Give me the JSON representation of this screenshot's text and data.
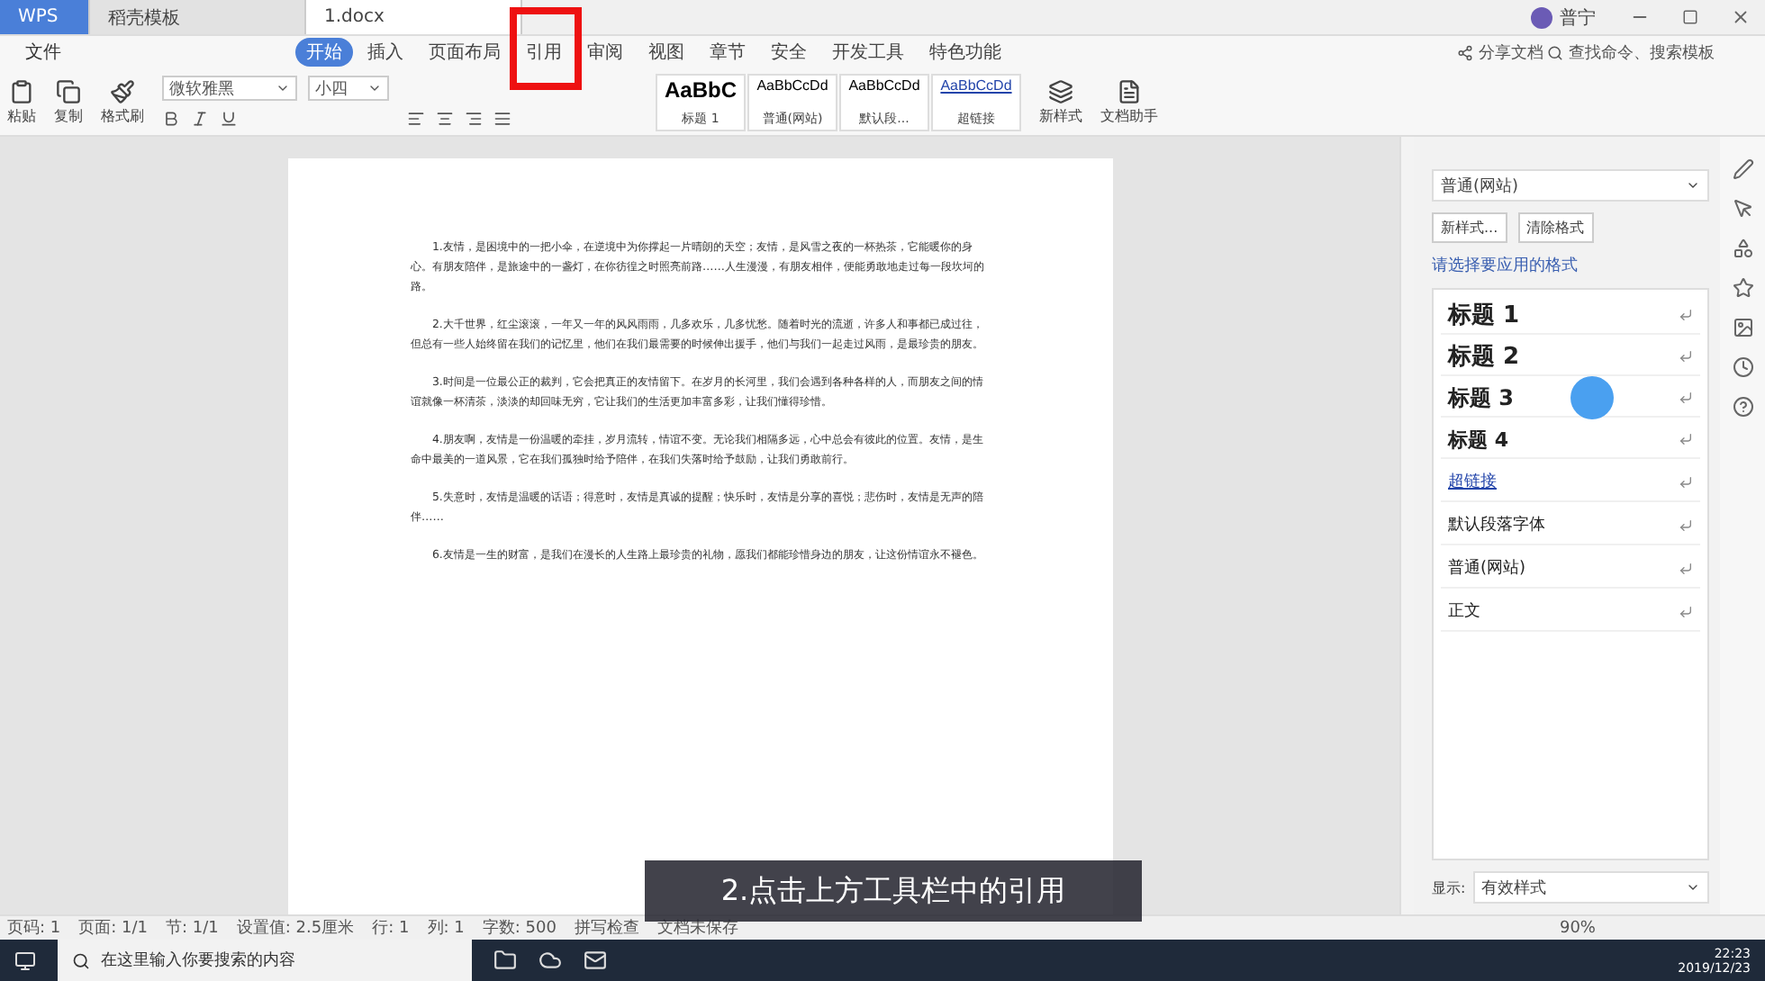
{
  "title_tabs": [
    {
      "label": "WPS",
      "selected": false,
      "kind": "home"
    },
    {
      "label": "稻壳模板",
      "selected": false,
      "kind": "doc"
    },
    {
      "label": "1.docx",
      "selected": true,
      "kind": "doc"
    }
  ],
  "account": {
    "name": "普宁"
  },
  "menu": {
    "file": "文件",
    "tabs": [
      {
        "label": "开始",
        "selected": true
      },
      {
        "label": "插入",
        "selected": false
      },
      {
        "label": "页面布局",
        "selected": false
      },
      {
        "label": "引用",
        "selected": false
      },
      {
        "label": "审阅",
        "selected": false
      },
      {
        "label": "视图",
        "selected": false
      },
      {
        "label": "章节",
        "selected": false
      },
      {
        "label": "安全",
        "selected": false
      },
      {
        "label": "开发工具",
        "selected": false
      },
      {
        "label": "特色功能",
        "selected": false
      }
    ],
    "share": "分享文档",
    "search_placeholder": "查找命令、搜索模板"
  },
  "ribbon": {
    "clipboard": [
      "粘贴",
      "复制",
      "格式刷"
    ],
    "font": "微软雅黑",
    "size": "小四",
    "styles": [
      {
        "sample": "AaBbC",
        "label": "标题 1",
        "kind": "big"
      },
      {
        "sample": "AaBbCcDd",
        "label": "普通(网站)",
        "kind": "normal"
      },
      {
        "sample": "AaBbCcDd",
        "label": "默认段...",
        "kind": "normal"
      },
      {
        "sample": "AaBbCcDd",
        "label": "超链接",
        "kind": "link"
      }
    ],
    "new_style": "新样式",
    "assistant": "文档助手"
  },
  "document": {
    "paragraphs": [
      "1.友情，是困境中的一把小伞，在逆境中为你撑起一片晴朗的天空；友情，是风雪之夜的一杯热茶，它能暖你的身心。有朋友陪伴，是旅途中的一盏灯，在你彷徨之时照亮前路……人生漫漫，有朋友相伴，便能勇敢地走过每一段坎坷的路。",
      "2.大千世界，红尘滚滚，一年又一年的风风雨雨，几多欢乐，几多忧愁。随着时光的流逝，许多人和事都已成过往，但总有一些人始终留在我们的记忆里，他们在我们最需要的时候伸出援手，他们与我们一起走过风雨，是最珍贵的朋友。",
      "3.时间是一位最公正的裁判，它会把真正的友情留下。在岁月的长河里，我们会遇到各种各样的人，而朋友之间的情谊就像一杯清茶，淡淡的却回味无穷，它让我们的生活更加丰富多彩，让我们懂得珍惜。",
      "4.朋友啊，友情是一份温暖的牵挂，岁月流转，情谊不变。无论我们相隔多远，心中总会有彼此的位置。友情，是生命中最美的一道风景，它在我们孤独时给予陪伴，在我们失落时给予鼓励，让我们勇敢前行。",
      "5.失意时，友情是温暖的话语；得意时，友情是真诚的提醒；快乐时，友情是分享的喜悦；悲伤时，友情是无声的陪伴……",
      "6.友情是一生的财富，是我们在漫长的人生路上最珍贵的礼物，愿我们都能珍惜身边的朋友，让这份情谊永不褪色。"
    ]
  },
  "styles_pane": {
    "current": "普通(网站)",
    "buttons": [
      "新样式...",
      "清除格式"
    ],
    "prompt": "请选择要应用的格式",
    "items": [
      {
        "label": "标题 1",
        "kind": "h1"
      },
      {
        "label": "标题 2",
        "kind": "h2"
      },
      {
        "label": "标题 3",
        "kind": "h3"
      },
      {
        "label": "标题 4",
        "kind": "h4"
      },
      {
        "label": "超链接",
        "kind": "link"
      },
      {
        "label": "默认段落字体",
        "kind": "plain"
      },
      {
        "label": "普通(网站)",
        "kind": "plain"
      },
      {
        "label": "正文",
        "kind": "plain"
      }
    ],
    "show_label": "显示:",
    "show_value": "有效样式"
  },
  "status_bar": {
    "items": [
      "页码: 1",
      "页面: 1/1",
      "节: 1/1",
      "设置值: 2.5厘米",
      "行: 1",
      "列: 1",
      "字数: 500",
      "拼写检查",
      "文档未保存"
    ],
    "zoom": "90%"
  },
  "caption": "2.点击上方工具栏中的引用",
  "taskbar": {
    "search_placeholder": "在这里输入你要搜索的内容",
    "time": "22:23",
    "date": "2019/12/23"
  }
}
